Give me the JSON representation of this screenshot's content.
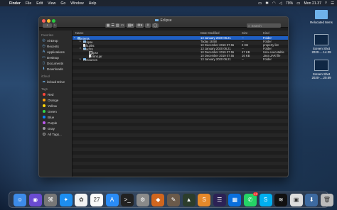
{
  "menubar": {
    "app_name": "Finder",
    "items": [
      "File",
      "Edit",
      "View",
      "Go",
      "Window",
      "Help"
    ],
    "battery": "79%",
    "clock": "Mon 21.37"
  },
  "window": {
    "title": "Eclipse",
    "search_placeholder": "Search"
  },
  "sidebar": {
    "favorites_header": "Favorites",
    "favorites": [
      {
        "label": "AirDrop",
        "icon": "airdrop-icon"
      },
      {
        "label": "Recents",
        "icon": "recents-icon"
      },
      {
        "label": "Applications",
        "icon": "applications-icon"
      },
      {
        "label": "Desktop",
        "icon": "desktop-icon"
      },
      {
        "label": "Documents",
        "icon": "documents-icon"
      },
      {
        "label": "Downloads",
        "icon": "downloads-icon"
      }
    ],
    "icloud_header": "iCloud",
    "icloud": [
      {
        "label": "iCloud Drive",
        "icon": "cloud-icon"
      }
    ],
    "tags_header": "Tags",
    "tags": [
      {
        "label": "Red",
        "color": "#ff453a"
      },
      {
        "label": "Orange",
        "color": "#ff9f0a"
      },
      {
        "label": "Yellow",
        "color": "#ffd60a"
      },
      {
        "label": "Green",
        "color": "#32d74b"
      },
      {
        "label": "Blue",
        "color": "#0a84ff"
      },
      {
        "label": "Purple",
        "color": "#bf5af2"
      },
      {
        "label": "Gray",
        "color": "#98989d"
      },
      {
        "label": "All Tags...",
        "color": ""
      }
    ]
  },
  "columns": {
    "name": "Name",
    "date_modified": "Date Modified",
    "size": "Size",
    "kind": "Kind"
  },
  "files": [
    {
      "name": "Contents",
      "date": "13 January 2020 06.21",
      "size": "--",
      "kind": "Folder",
      "type": "folder",
      "indent": 0,
      "expanded": true,
      "selected": true
    },
    {
      "name": "Eclipse",
      "date": "Today 18.58",
      "size": "--",
      "kind": "Folder",
      "type": "folder",
      "indent": 1,
      "expanded": false,
      "selected": false
    },
    {
      "name": "Info.plist",
      "date": "10 December 2019 07.55",
      "size": "2 KB",
      "kind": "property list",
      "type": "file",
      "indent": 1,
      "expanded": null,
      "selected": false
    },
    {
      "name": "MacOS",
      "date": "13 January 2020 06.21",
      "size": "--",
      "kind": "Folder",
      "type": "folder",
      "indent": 1,
      "expanded": true,
      "selected": false
    },
    {
      "name": "eclipse",
      "date": "10 December 2019 07.55",
      "size": "47 KB",
      "kind": "Unix executable",
      "type": "exe",
      "indent": 2,
      "expanded": null,
      "selected": false
    },
    {
      "name": "jvmlink.jar",
      "date": "10 December 2019 07.55",
      "size": "16 KB",
      "kind": "Java JAR file",
      "type": "file",
      "indent": 2,
      "expanded": null,
      "selected": false
    },
    {
      "name": "Resources",
      "date": "13 January 2020 06.21",
      "size": "--",
      "kind": "Folder",
      "type": "folder",
      "indent": 1,
      "expanded": false,
      "selected": false
    }
  ],
  "desktop_icons": [
    {
      "label": "Relocated Items",
      "kind": "folder"
    },
    {
      "label": "Screen Shot 2020-....14.39",
      "kind": "screenshot"
    },
    {
      "label": "Screen Shot 2020-....20.59",
      "kind": "screenshot"
    }
  ],
  "dock": [
    {
      "name": "finder-icon",
      "bg": "#3d8be8",
      "glyph": "☺"
    },
    {
      "name": "siri-icon",
      "bg": "#6a4bd1",
      "glyph": "◉"
    },
    {
      "name": "launchpad-icon",
      "bg": "#777",
      "glyph": "⌘"
    },
    {
      "name": "safari-icon",
      "bg": "#1d8ef0",
      "glyph": "✦"
    },
    {
      "name": "photos-icon",
      "bg": "#f3f3f3",
      "glyph": "✿"
    },
    {
      "name": "calendar-icon",
      "bg": "#fafafa",
      "glyph": "27"
    },
    {
      "name": "appstore-icon",
      "bg": "#2a8cf7",
      "glyph": "A"
    },
    {
      "name": "terminal-icon",
      "bg": "#222",
      "glyph": ">_"
    },
    {
      "name": "system-preferences-icon",
      "bg": "#8a8a8a",
      "glyph": "⚙"
    },
    {
      "name": "app-icon",
      "bg": "#d0661e",
      "glyph": "◆"
    },
    {
      "name": "gimp-icon",
      "bg": "#6b5a4a",
      "glyph": "✎"
    },
    {
      "name": "android-studio-icon",
      "bg": "#2c3d2c",
      "glyph": "▲"
    },
    {
      "name": "sublime-icon",
      "bg": "#e6892a",
      "glyph": "S"
    },
    {
      "name": "eclipse-app-icon",
      "bg": "#2c2255",
      "glyph": "☰"
    },
    {
      "name": "trello-icon",
      "bg": "#0a6fdd",
      "glyph": "▦"
    },
    {
      "name": "whatsapp-icon",
      "bg": "#25d366",
      "glyph": "✆",
      "badge": "17"
    },
    {
      "name": "skype-icon",
      "bg": "#00aff0",
      "glyph": "S"
    },
    {
      "name": "spotify-icon",
      "bg": "#111",
      "glyph": "≋"
    },
    {
      "name": "preview-icon",
      "bg": "#ddd",
      "glyph": "▣"
    },
    {
      "name": "downloads-stack-icon",
      "bg": "#3d6aa0",
      "glyph": "⬇"
    },
    {
      "name": "trash-icon",
      "bg": "#bbb",
      "glyph": "🗑"
    }
  ]
}
